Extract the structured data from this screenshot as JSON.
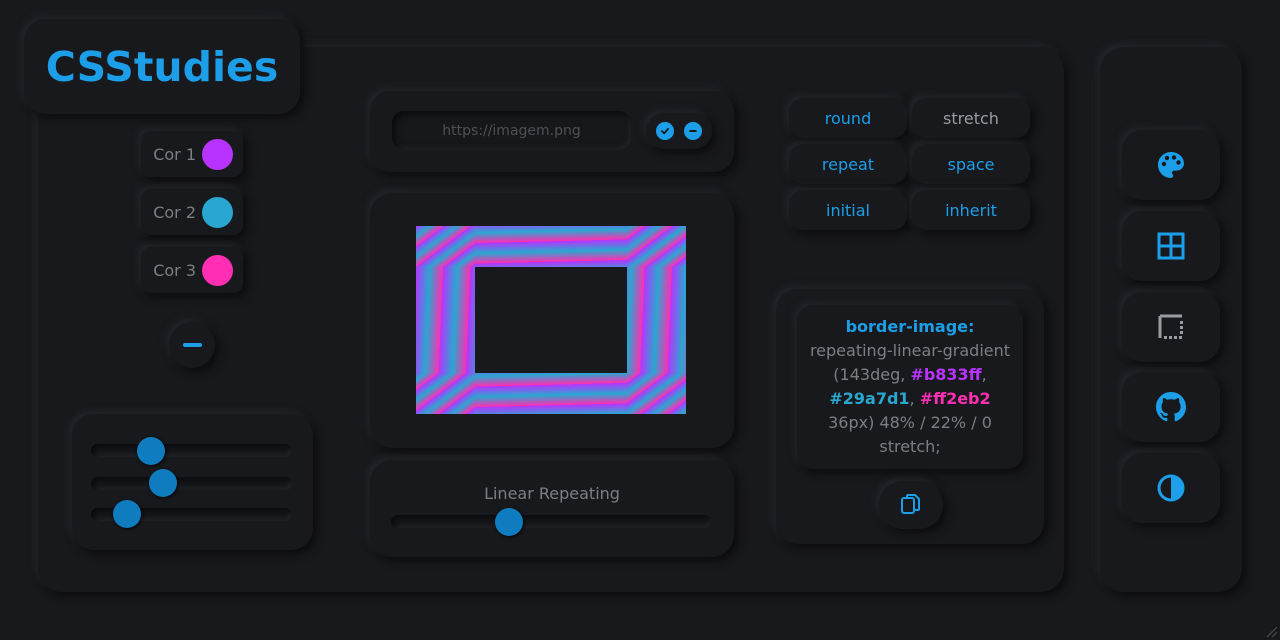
{
  "app": {
    "logo": "CSStudies"
  },
  "colors": [
    {
      "label": "Cor 1",
      "value": "#b833ff"
    },
    {
      "label": "Cor 2",
      "value": "#29a7d1"
    },
    {
      "label": "Cor 3",
      "value": "#ff2eb2"
    }
  ],
  "sliders": {
    "values": [
      0.3,
      0.36,
      0.18
    ]
  },
  "url": {
    "placeholder": "https://imagem.png"
  },
  "linear": {
    "label": "Linear Repeating",
    "value": 0.37
  },
  "options": [
    "round",
    "stretch",
    "repeat",
    "space",
    "initial",
    "inherit"
  ],
  "code": {
    "property": "border-image:",
    "fn": "repeating-linear-gradient (143deg,",
    "c1": "#b833ff",
    "c2": "#29a7d1",
    "c3": "#ff2eb2",
    "rest": "36px) 48% / 22% / 0 stretch;",
    "sep": ", "
  },
  "accent": "#1c9fe8",
  "sidebar": [
    "palette-icon",
    "grid-icon",
    "border-dotted-icon",
    "github-icon",
    "contrast-icon"
  ]
}
